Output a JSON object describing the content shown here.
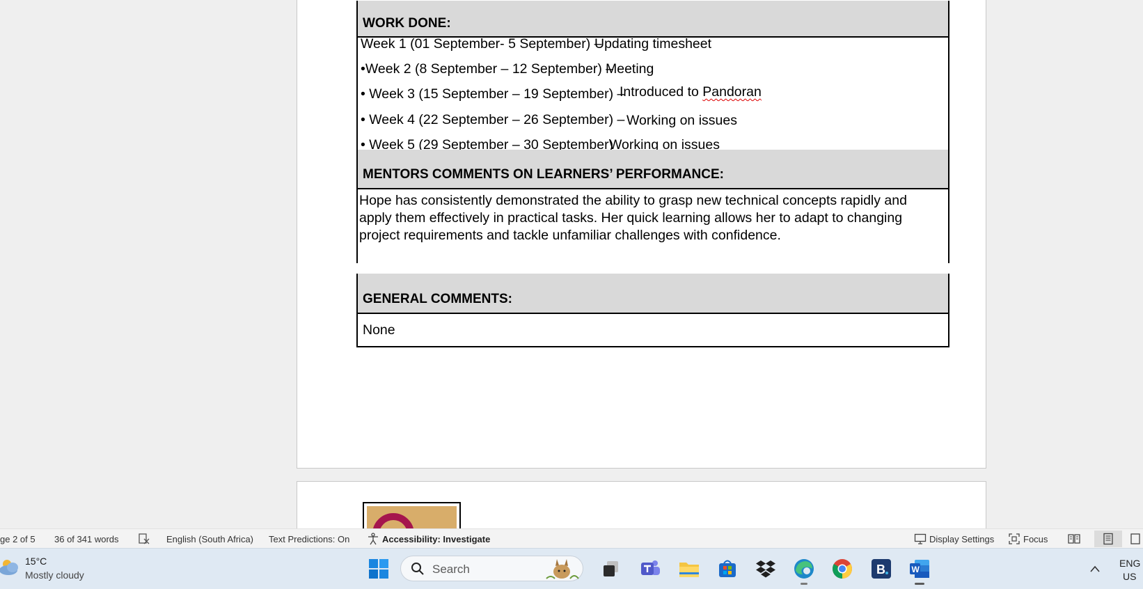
{
  "document": {
    "work_done": {
      "heading": "WORK DONE:",
      "weeks": [
        {
          "label": "Week 1 (01 September- 5 September) –",
          "task": "Updating  timesheet"
        },
        {
          "label": "•Week 2 (8 September – 12 September) –",
          "task": "Meeting"
        },
        {
          "label": "• Week 3 (15 September – 19 September) –",
          "task_prefix": "Introduced to ",
          "task_flagged": "Pandoran"
        },
        {
          "label": "• Week 4 (22 September – 26 September) –",
          "task": "Working on issues"
        },
        {
          "label": "• Week 5 (29 September – 30 September)",
          "task": "Working on issues"
        }
      ]
    },
    "mentor_comments": {
      "heading": "MENTORS COMMENTS ON LEARNERS’ PERFORMANCE:",
      "text": " Hope has consistently demonstrated the ability to grasp new technical concepts rapidly and apply them effectively in practical tasks. Her quick learning allows her to adapt to changing project requirements and tackle unfamiliar challenges with confidence."
    },
    "general_comments": {
      "heading": "GENERAL COMMENTS:",
      "text": "None"
    }
  },
  "status_bar": {
    "page": "ge 2 of 5",
    "words": "36 of 341 words",
    "language": "English (South Africa)",
    "text_predictions": "Text Predictions: On",
    "accessibility": "Accessibility: Investigate",
    "display_settings": "Display Settings",
    "focus": "Focus"
  },
  "taskbar": {
    "weather_temp": "15°C",
    "weather_condition": "Mostly cloudy",
    "search_placeholder": "Search",
    "apps": [
      "file-explorer-task-view",
      "teams",
      "file-explorer",
      "microsoft-store",
      "dropbox",
      "edge",
      "chrome",
      "b-app",
      "word"
    ],
    "lang_line1": "ENG",
    "lang_line2": "US"
  },
  "colors": {
    "section_header_bg": "#d9d9d9",
    "taskbar_bg": "#dfe9f3",
    "spell_error": "#d00000",
    "word_blue": "#185abd"
  }
}
